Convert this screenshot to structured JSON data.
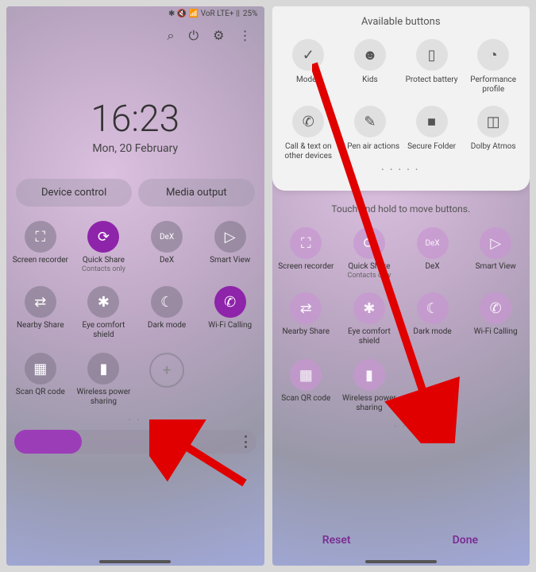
{
  "status": {
    "icons": "✱ 🔇 📶 VoR LTE+ ||",
    "battery": "25%"
  },
  "topbar": {
    "search": "search-icon",
    "power": "power-icon",
    "settings": "settings-icon",
    "menu": "menu-icon"
  },
  "clock": {
    "time": "16:23",
    "date": "Mon, 20 February"
  },
  "pills": {
    "device": "Device control",
    "media": "Media output"
  },
  "tiles": [
    {
      "label": "Screen recorder",
      "sub": "",
      "g": "⛶",
      "c": "grey"
    },
    {
      "label": "Quick Share",
      "sub": "Contacts only",
      "g": "⟳",
      "c": "purple"
    },
    {
      "label": "DeX",
      "sub": "",
      "g": "DeX",
      "c": "grey"
    },
    {
      "label": "Smart View",
      "sub": "",
      "g": "▷",
      "c": "grey"
    },
    {
      "label": "Nearby Share",
      "sub": "",
      "g": "⇄",
      "c": "grey"
    },
    {
      "label": "Eye comfort shield",
      "sub": "",
      "g": "✱",
      "c": "grey"
    },
    {
      "label": "Dark mode",
      "sub": "",
      "g": "☾",
      "c": "grey"
    },
    {
      "label": "Wi-Fi Calling",
      "sub": "",
      "g": "✆",
      "c": "purple"
    },
    {
      "label": "Scan QR code",
      "sub": "",
      "g": "▦",
      "c": "grey"
    },
    {
      "label": "Wireless power sharing",
      "sub": "",
      "g": "▮",
      "c": "grey"
    }
  ],
  "drawer": {
    "title": "Available buttons",
    "items": [
      {
        "label": "Modes",
        "g": "✓"
      },
      {
        "label": "Kids",
        "g": "☻"
      },
      {
        "label": "Protect battery",
        "g": "▯"
      },
      {
        "label": "Performance profile",
        "g": "◔"
      },
      {
        "label": "Call & text on other devices",
        "g": "✆"
      },
      {
        "label": "S Pen air actions",
        "g": "✎"
      },
      {
        "label": "Secure Folder",
        "g": "■"
      },
      {
        "label": "Dolby Atmos",
        "g": "◫"
      }
    ]
  },
  "hint": "Touch and hold to move buttons.",
  "buttons": {
    "reset": "Reset",
    "done": "Done"
  }
}
